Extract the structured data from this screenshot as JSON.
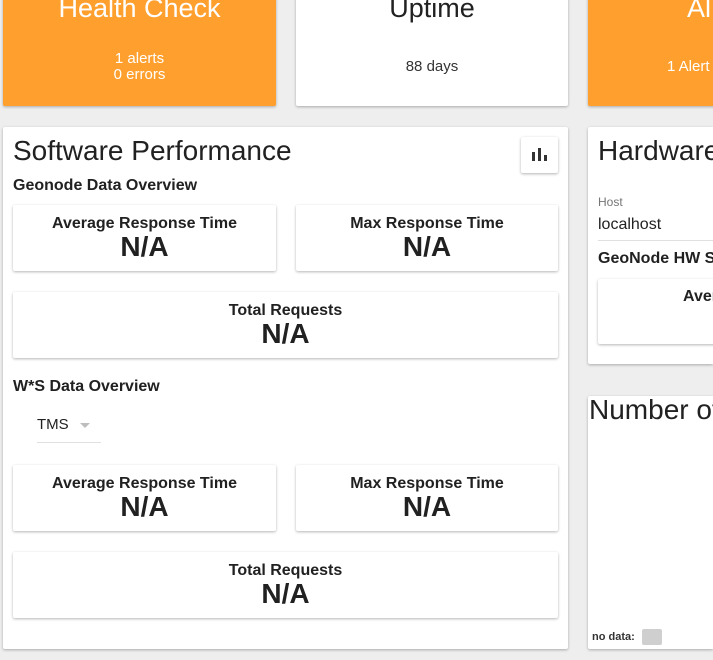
{
  "health_check": {
    "title": "Health Check",
    "alerts": "1 alerts",
    "errors": "0 errors"
  },
  "uptime": {
    "title": "Uptime",
    "value": "88 days"
  },
  "alerts_card": {
    "title": "Al",
    "value": "1 Alert"
  },
  "software": {
    "title": "Software Performance",
    "geonode_overview": "Geonode Data Overview",
    "geonode": {
      "avg_label": "Average Response Time",
      "avg_value": "N/A",
      "max_label": "Max Response Time",
      "max_value": "N/A",
      "total_label": "Total Requests",
      "total_value": "N/A"
    },
    "ws_overview": "W*S Data Overview",
    "ws_select": "TMS",
    "ws": {
      "avg_label": "Average Response Time",
      "avg_value": "N/A",
      "max_label": "Max Response Time",
      "max_value": "N/A",
      "total_label": "Total Requests",
      "total_value": "N/A"
    }
  },
  "hardware": {
    "title": "Hardware",
    "host_label": "Host",
    "host_value": "localhost",
    "hw_stats": "GeoNode HW St",
    "avg_label": "Aver"
  },
  "number_of": {
    "title": "Number of",
    "no_data": "no data:"
  },
  "colors": {
    "orange": "#ffa02e",
    "swatch": "#cfcfcf"
  }
}
